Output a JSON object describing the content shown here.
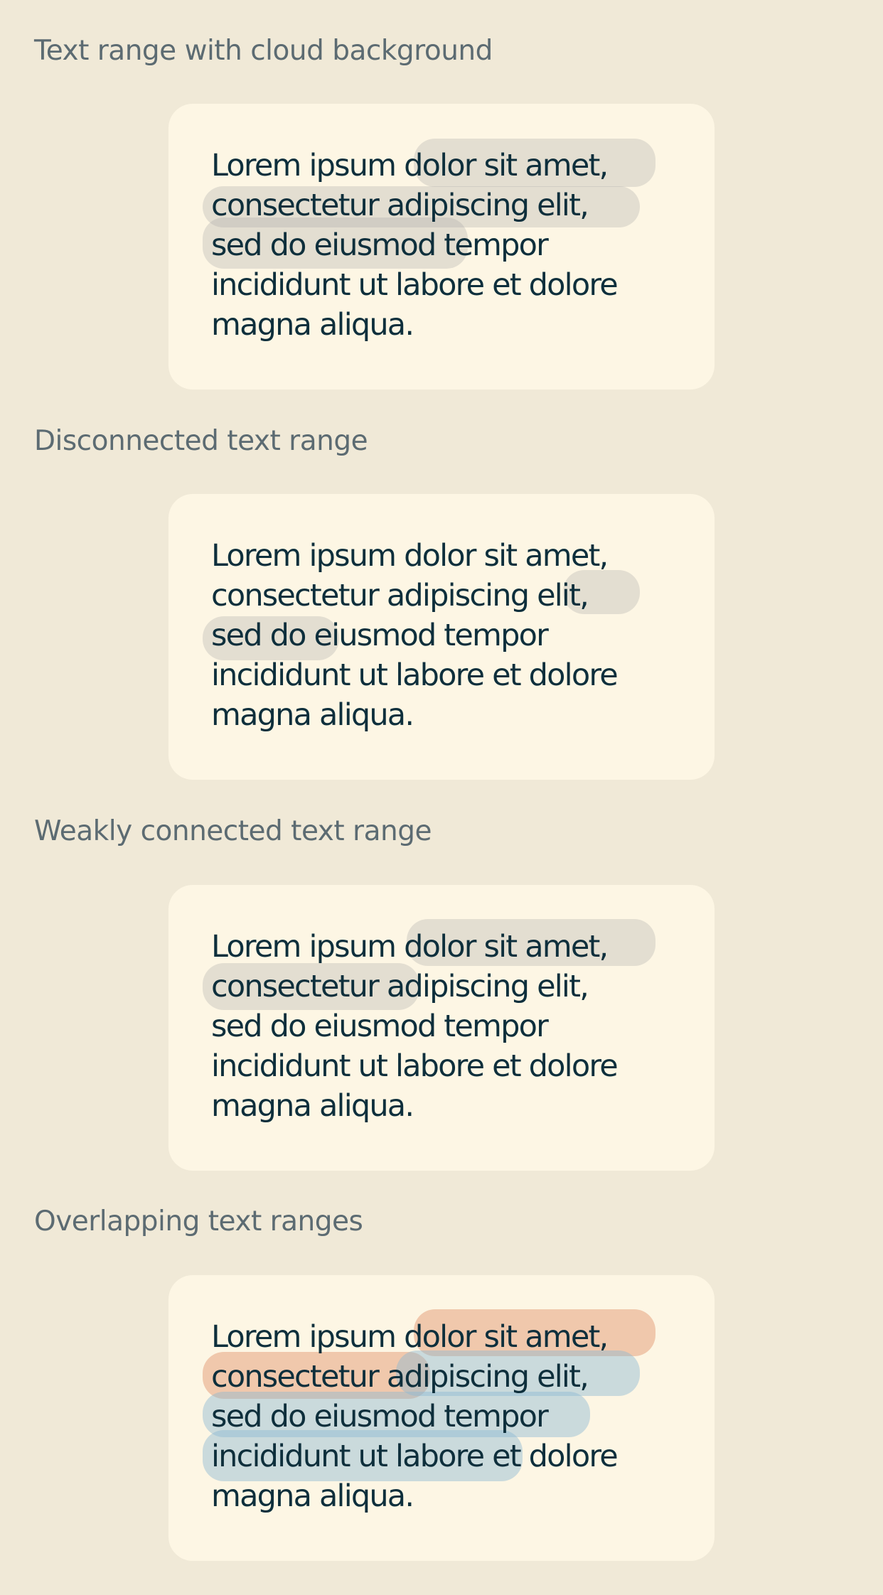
{
  "sections": [
    {
      "title": "Text range with cloud background",
      "lines": [
        "Lorem ipsum dolor sit amet,",
        "consectetur adipiscing elit,",
        "sed do eiusmod tempor",
        "incididunt ut labore et dolore",
        "magna aliqua."
      ]
    },
    {
      "title": "Disconnected text range",
      "lines": [
        "Lorem ipsum dolor sit amet,",
        "consectetur adipiscing elit,",
        "sed do eiusmod tempor",
        "incididunt ut labore et dolore",
        "magna aliqua."
      ]
    },
    {
      "title": "Weakly connected text range",
      "lines": [
        "Lorem ipsum dolor sit amet,",
        "consectetur adipiscing elit,",
        "sed do eiusmod tempor",
        "incididunt ut labore et dolore",
        "magna aliqua."
      ]
    },
    {
      "title": "Overlapping text ranges",
      "lines": [
        "Lorem ipsum dolor sit amet,",
        "consectetur adipiscing elit,",
        "sed do eiusmod tempor",
        "incididunt ut labore et dolore",
        "magna aliqua."
      ]
    }
  ],
  "colors": {
    "page_background": "#f0e9d7",
    "card_background": "#fdf6e4",
    "title_text": "#5c6b72",
    "body_text": "#0e2f3c",
    "highlight_gray": "#dcdad0",
    "highlight_orange": "#efc9ad",
    "highlight_blue": "#c6dde2"
  }
}
